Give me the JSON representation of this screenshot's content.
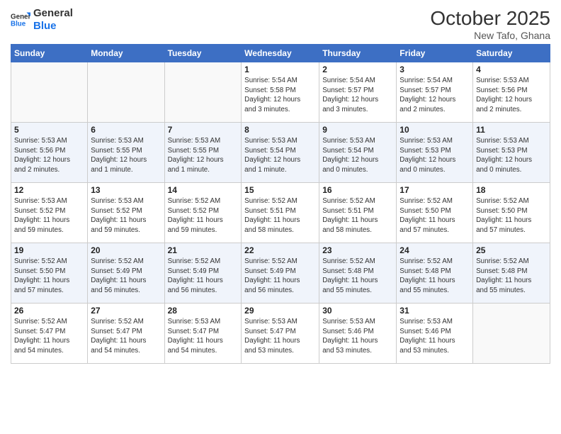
{
  "logo": {
    "line1": "General",
    "line2": "Blue"
  },
  "title": "October 2025",
  "location": "New Tafo, Ghana",
  "weekdays": [
    "Sunday",
    "Monday",
    "Tuesday",
    "Wednesday",
    "Thursday",
    "Friday",
    "Saturday"
  ],
  "weeks": [
    [
      {
        "day": "",
        "info": ""
      },
      {
        "day": "",
        "info": ""
      },
      {
        "day": "",
        "info": ""
      },
      {
        "day": "1",
        "info": "Sunrise: 5:54 AM\nSunset: 5:58 PM\nDaylight: 12 hours\nand 3 minutes."
      },
      {
        "day": "2",
        "info": "Sunrise: 5:54 AM\nSunset: 5:57 PM\nDaylight: 12 hours\nand 3 minutes."
      },
      {
        "day": "3",
        "info": "Sunrise: 5:54 AM\nSunset: 5:57 PM\nDaylight: 12 hours\nand 2 minutes."
      },
      {
        "day": "4",
        "info": "Sunrise: 5:53 AM\nSunset: 5:56 PM\nDaylight: 12 hours\nand 2 minutes."
      }
    ],
    [
      {
        "day": "5",
        "info": "Sunrise: 5:53 AM\nSunset: 5:56 PM\nDaylight: 12 hours\nand 2 minutes."
      },
      {
        "day": "6",
        "info": "Sunrise: 5:53 AM\nSunset: 5:55 PM\nDaylight: 12 hours\nand 1 minute."
      },
      {
        "day": "7",
        "info": "Sunrise: 5:53 AM\nSunset: 5:55 PM\nDaylight: 12 hours\nand 1 minute."
      },
      {
        "day": "8",
        "info": "Sunrise: 5:53 AM\nSunset: 5:54 PM\nDaylight: 12 hours\nand 1 minute."
      },
      {
        "day": "9",
        "info": "Sunrise: 5:53 AM\nSunset: 5:54 PM\nDaylight: 12 hours\nand 0 minutes."
      },
      {
        "day": "10",
        "info": "Sunrise: 5:53 AM\nSunset: 5:53 PM\nDaylight: 12 hours\nand 0 minutes."
      },
      {
        "day": "11",
        "info": "Sunrise: 5:53 AM\nSunset: 5:53 PM\nDaylight: 12 hours\nand 0 minutes."
      }
    ],
    [
      {
        "day": "12",
        "info": "Sunrise: 5:53 AM\nSunset: 5:52 PM\nDaylight: 11 hours\nand 59 minutes."
      },
      {
        "day": "13",
        "info": "Sunrise: 5:53 AM\nSunset: 5:52 PM\nDaylight: 11 hours\nand 59 minutes."
      },
      {
        "day": "14",
        "info": "Sunrise: 5:52 AM\nSunset: 5:52 PM\nDaylight: 11 hours\nand 59 minutes."
      },
      {
        "day": "15",
        "info": "Sunrise: 5:52 AM\nSunset: 5:51 PM\nDaylight: 11 hours\nand 58 minutes."
      },
      {
        "day": "16",
        "info": "Sunrise: 5:52 AM\nSunset: 5:51 PM\nDaylight: 11 hours\nand 58 minutes."
      },
      {
        "day": "17",
        "info": "Sunrise: 5:52 AM\nSunset: 5:50 PM\nDaylight: 11 hours\nand 57 minutes."
      },
      {
        "day": "18",
        "info": "Sunrise: 5:52 AM\nSunset: 5:50 PM\nDaylight: 11 hours\nand 57 minutes."
      }
    ],
    [
      {
        "day": "19",
        "info": "Sunrise: 5:52 AM\nSunset: 5:50 PM\nDaylight: 11 hours\nand 57 minutes."
      },
      {
        "day": "20",
        "info": "Sunrise: 5:52 AM\nSunset: 5:49 PM\nDaylight: 11 hours\nand 56 minutes."
      },
      {
        "day": "21",
        "info": "Sunrise: 5:52 AM\nSunset: 5:49 PM\nDaylight: 11 hours\nand 56 minutes."
      },
      {
        "day": "22",
        "info": "Sunrise: 5:52 AM\nSunset: 5:49 PM\nDaylight: 11 hours\nand 56 minutes."
      },
      {
        "day": "23",
        "info": "Sunrise: 5:52 AM\nSunset: 5:48 PM\nDaylight: 11 hours\nand 55 minutes."
      },
      {
        "day": "24",
        "info": "Sunrise: 5:52 AM\nSunset: 5:48 PM\nDaylight: 11 hours\nand 55 minutes."
      },
      {
        "day": "25",
        "info": "Sunrise: 5:52 AM\nSunset: 5:48 PM\nDaylight: 11 hours\nand 55 minutes."
      }
    ],
    [
      {
        "day": "26",
        "info": "Sunrise: 5:52 AM\nSunset: 5:47 PM\nDaylight: 11 hours\nand 54 minutes."
      },
      {
        "day": "27",
        "info": "Sunrise: 5:52 AM\nSunset: 5:47 PM\nDaylight: 11 hours\nand 54 minutes."
      },
      {
        "day": "28",
        "info": "Sunrise: 5:53 AM\nSunset: 5:47 PM\nDaylight: 11 hours\nand 54 minutes."
      },
      {
        "day": "29",
        "info": "Sunrise: 5:53 AM\nSunset: 5:47 PM\nDaylight: 11 hours\nand 53 minutes."
      },
      {
        "day": "30",
        "info": "Sunrise: 5:53 AM\nSunset: 5:46 PM\nDaylight: 11 hours\nand 53 minutes."
      },
      {
        "day": "31",
        "info": "Sunrise: 5:53 AM\nSunset: 5:46 PM\nDaylight: 11 hours\nand 53 minutes."
      },
      {
        "day": "",
        "info": ""
      }
    ]
  ]
}
